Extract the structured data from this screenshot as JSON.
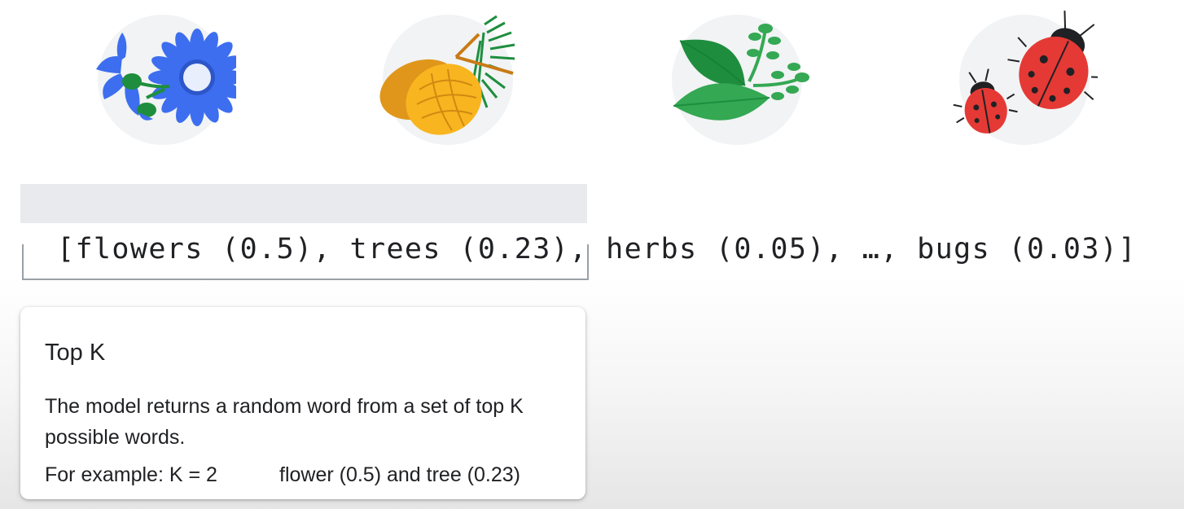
{
  "illustrations": [
    {
      "icon": "flowers-icon"
    },
    {
      "icon": "trees-icon"
    },
    {
      "icon": "herbs-icon"
    },
    {
      "icon": "bugs-icon"
    }
  ],
  "sequence": {
    "open": "[",
    "items": [
      {
        "text": "flowers (0.5), ",
        "highlighted": true
      },
      {
        "text": "trees (0.23), ",
        "highlighted": true
      },
      {
        "text": "herbs (0.05), ",
        "highlighted": false
      },
      {
        "text": "…, ",
        "highlighted": false
      },
      {
        "text": "bugs (0.03)",
        "highlighted": false
      }
    ],
    "close": "]",
    "highlight_color": "#e8eaed"
  },
  "card": {
    "title": "Top K",
    "body": "The model returns a random word from a set of top K possible words.",
    "example_label": "For example: K = 2",
    "example_result": "flower (0.5) and tree (0.23)"
  },
  "colors": {
    "flower_blue": "#3d6ef0",
    "pinecone_orange": "#f5a51d",
    "leaf_green": "#34a853",
    "ladybug_red": "#e53935"
  }
}
